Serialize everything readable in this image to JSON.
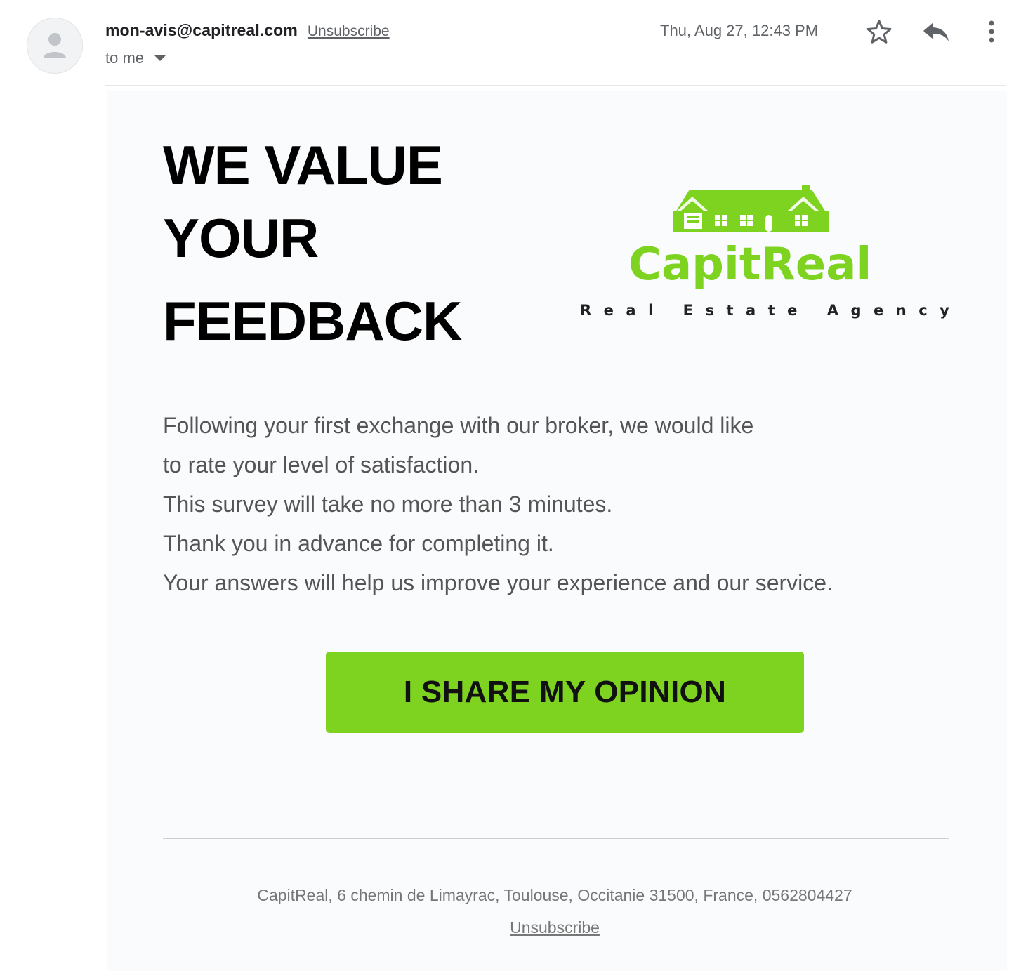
{
  "header": {
    "sender_email": "mon-avis@capitreal.com",
    "unsubscribe_label": "Unsubscribe",
    "recipient_label": "to me",
    "timestamp": "Thu, Aug 27, 12:43 PM",
    "icons": [
      "person-icon",
      "star-icon",
      "reply-icon",
      "more-vert-icon",
      "caret-down-icon"
    ]
  },
  "email": {
    "headline": [
      "WE VALUE",
      "YOUR",
      "FEEDBACK"
    ],
    "logo": {
      "name": "CapitReal",
      "tagline": "Real Estate Agency",
      "brand_color": "#7ed321"
    },
    "paragraph": [
      "Following your first exchange with our broker, we would like",
      "to rate your level of satisfaction.",
      "This survey will take no more than 3 minutes.",
      "Thank you in advance for completing it.",
      "Your answers will help us improve your experience and our service."
    ],
    "cta_label": "I SHARE MY OPINION",
    "cta_color": "#7ed321",
    "footer": {
      "address": "CapitReal, 6 chemin de Limayrac, Toulouse, Occitanie 31500, France, 0562804427",
      "unsubscribe_label": "Unsubscribe"
    }
  }
}
